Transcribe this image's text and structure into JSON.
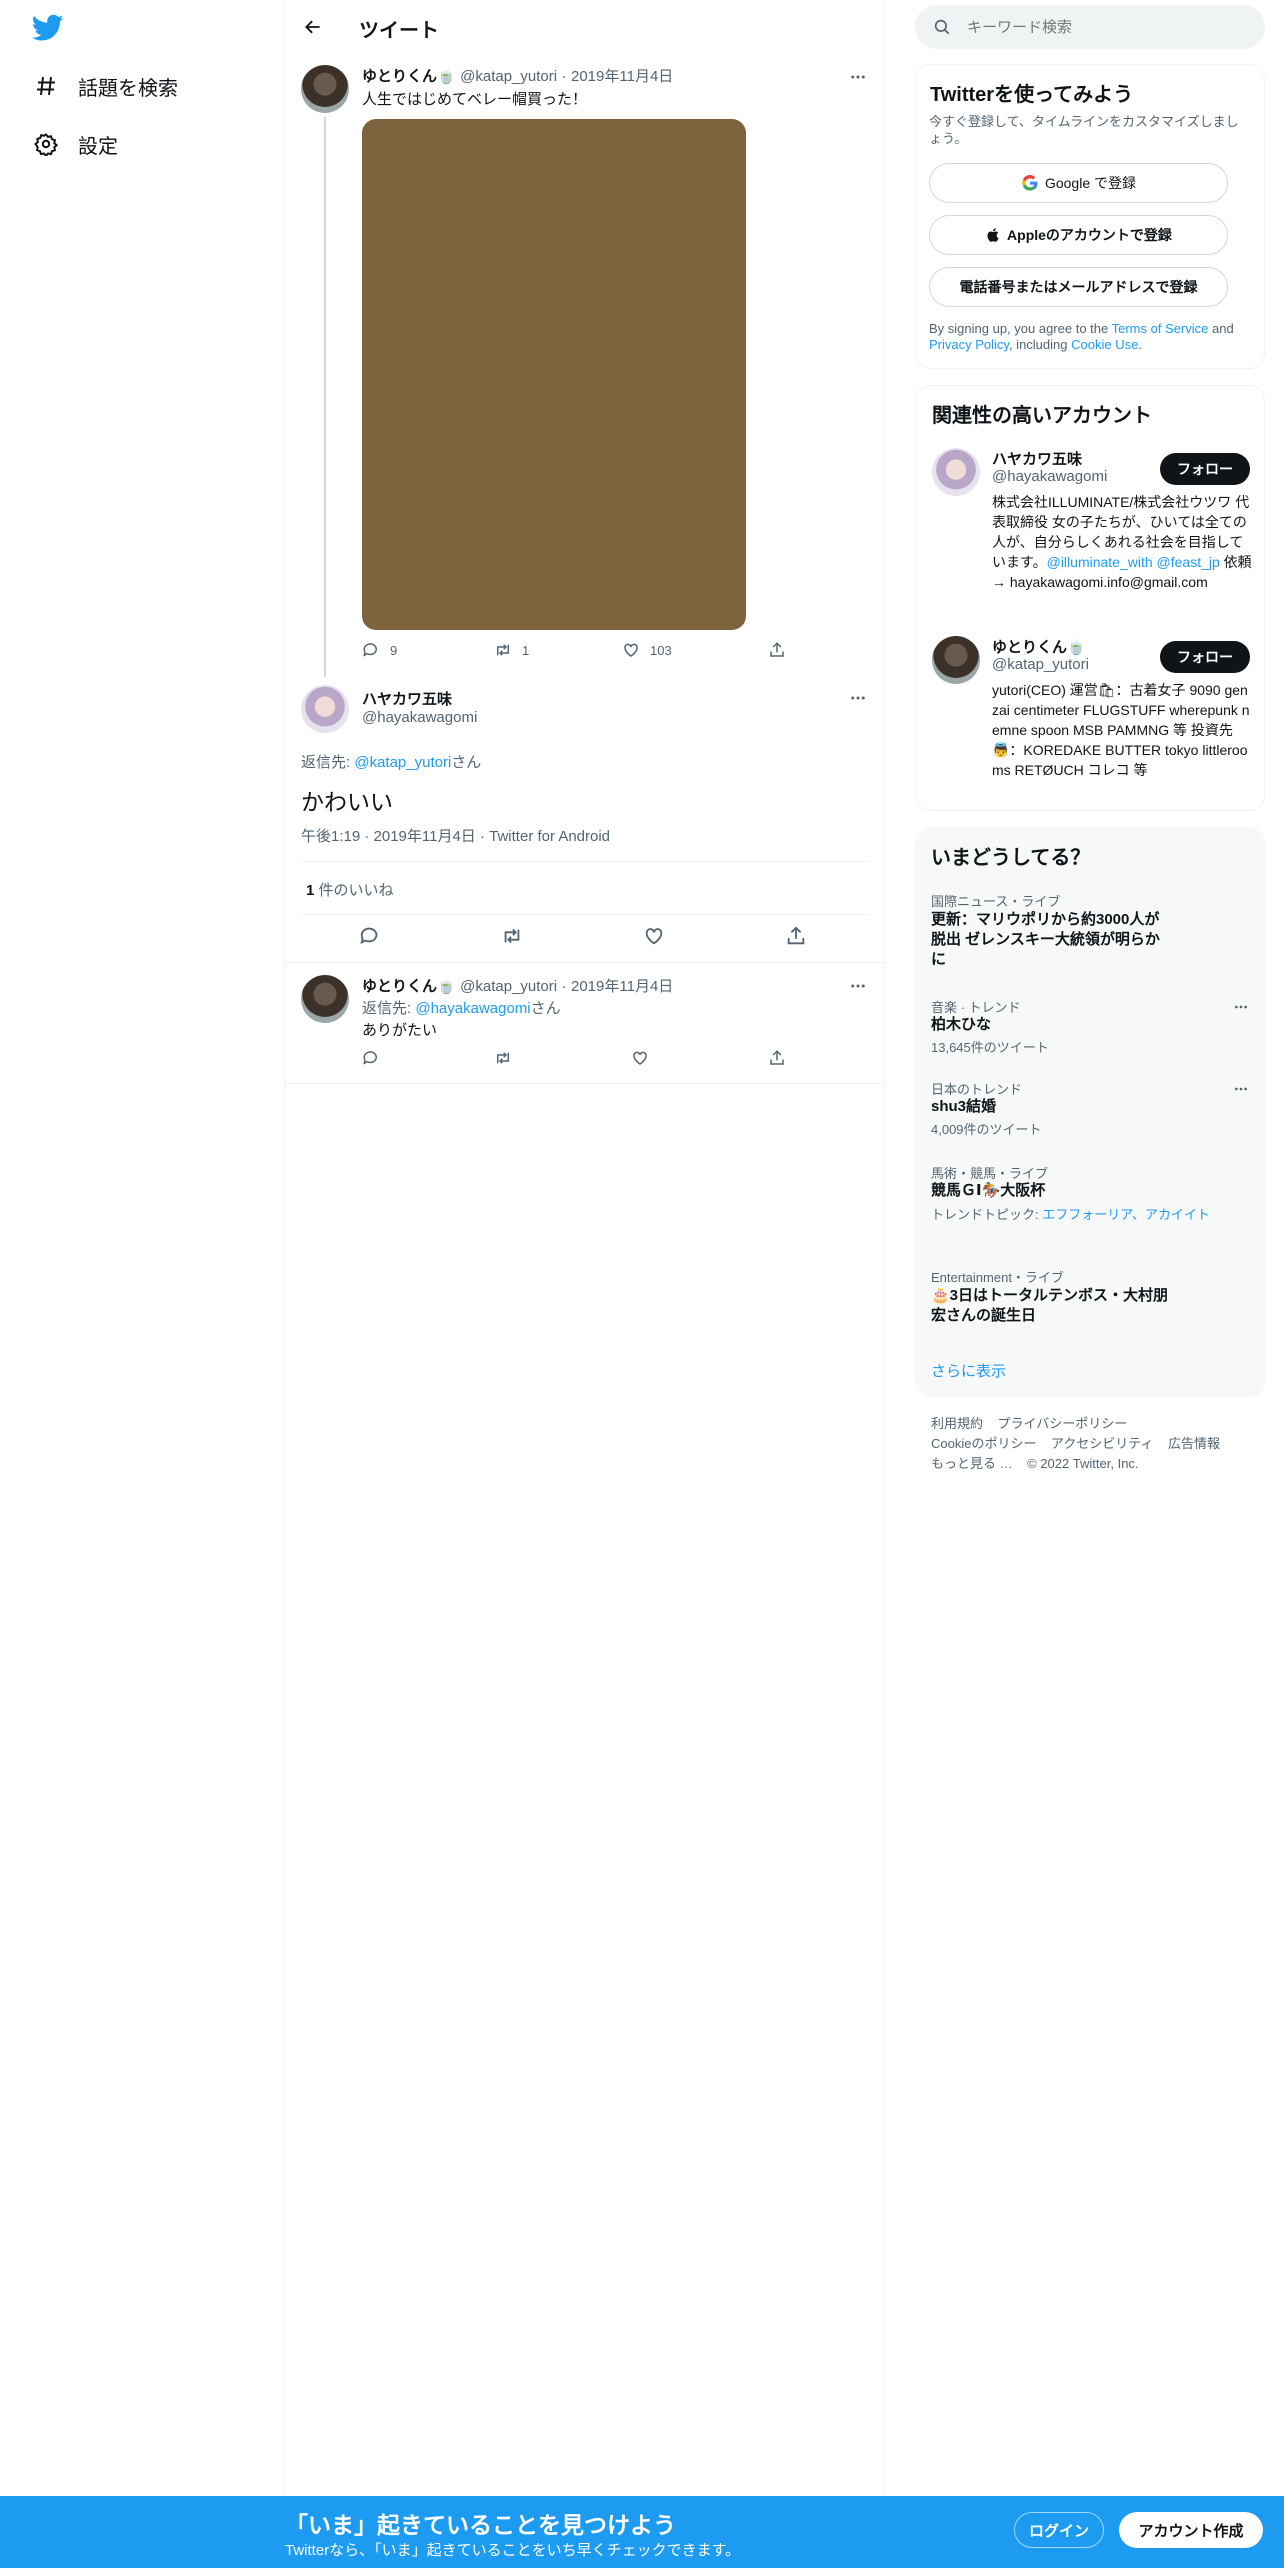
{
  "colors": {
    "accent": "#1d9bf0",
    "text": "#0f1419",
    "muted": "#536471",
    "media": "#7d643f"
  },
  "nav": {
    "items": [
      {
        "label": "話題を検索",
        "icon": "hashtag-icon"
      },
      {
        "label": "設定",
        "icon": "gear-icon"
      }
    ]
  },
  "header": {
    "title": "ツイート"
  },
  "thread": {
    "parent": {
      "name": "ゆとりくん🍵",
      "handle": "@katap_yutori",
      "date": "2019年11月4日",
      "text": "人生ではじめてベレー帽買った！",
      "replies": "9",
      "retweets": "1",
      "likes": "103"
    },
    "main": {
      "name": "ハヤカワ五味",
      "handle": "@hayakawagomi",
      "reply_prefix": "返信先: ",
      "reply_to": "@katap_yutori",
      "reply_suffix": "さん",
      "text": "かわいい",
      "meta": "午後1:19 · 2019年11月4日 · Twitter for Android",
      "likes_count": "1",
      "likes_label": " 件のいいね"
    },
    "reply": {
      "name": "ゆとりくん🍵",
      "handle": "@katap_yutori",
      "date": "2019年11月4日",
      "reply_prefix": "返信先: ",
      "reply_to": "@hayakawagomi",
      "reply_suffix": "さん",
      "text": "ありがたい"
    }
  },
  "search": {
    "placeholder": "キーワード検索"
  },
  "signup": {
    "title": "Twitterを使ってみよう",
    "subtitle": "今すぐ登録して、タイムラインをカスタマイズしましょう。",
    "google": "Google で登録",
    "apple": "Appleのアカウントで登録",
    "phone": "電話番号またはメールアドレスで登録",
    "legal_1": "By signing up, you agree to the ",
    "terms": "Terms of Service",
    "legal_2": " and ",
    "privacy": "Privacy Policy",
    "legal_3": ", including ",
    "cookie": "Cookie Use",
    "legal_4": "."
  },
  "related": {
    "title": "関連性の高いアカウント",
    "follow_label": "フォロー",
    "accounts": [
      {
        "name": "ハヤカワ五味",
        "handle": "@hayakawagomi",
        "bio_1": "株式会社ILLUMINATE/株式会社ウツワ 代表取締役 女の子たちが、ひいては全ての人が、自分らしくあれる社会を目指しています。",
        "bio_link_1": "@illuminate_with",
        "bio_link_2": "@feast_jp",
        "bio_2": " 依頼→ hayakawagomi.info@gmail.com"
      },
      {
        "name": "ゆとりくん🍵",
        "handle": "@katap_yutori",
        "bio": "yutori(CEO) 運営🛍：古着女子 9090 genzai centimeter FLUGSTUFF wherepunk nemne spoon MSB PAMMNG 等 投資先👼：KOREDAKE BUTTER tokyo littlerooms RETØUCH コレコ 等"
      }
    ]
  },
  "trends": {
    "title": "いまどうしてる？",
    "items": [
      {
        "meta": "国際ニュース・ライブ",
        "title": "更新：マリウポリから約3000人が脱出 ゼレンスキー大統領が明らかに"
      },
      {
        "meta": "音楽 · トレンド",
        "title": "柏木ひな",
        "count": "13,645件のツイート"
      },
      {
        "meta": "日本のトレンド",
        "title": "shu3結婚",
        "count": "4,009件のツイート"
      },
      {
        "meta": "馬術・競馬・ライブ",
        "title": "競馬ＧⅠ🏇大阪杯",
        "topic_prefix": "トレンドトピック: ",
        "topic": "エフフォーリア、アカイイト"
      },
      {
        "meta": "Entertainment・ライブ",
        "title": "🎂3日はトータルテンボス・大村朋宏さんの誕生日"
      }
    ],
    "more": "さらに表示"
  },
  "footer": {
    "links": [
      "利用規約",
      "プライバシーポリシー",
      "Cookieのポリシー",
      "アクセシビリティ",
      "広告情報",
      "もっと見る …"
    ],
    "copyright": "© 2022 Twitter, Inc."
  },
  "bottombar": {
    "title": "「いま」起きていることを見つけよう",
    "subtitle": "Twitterなら、「いま」起きていることをいち早くチェックできます。",
    "login": "ログイン",
    "signup": "アカウント作成"
  }
}
